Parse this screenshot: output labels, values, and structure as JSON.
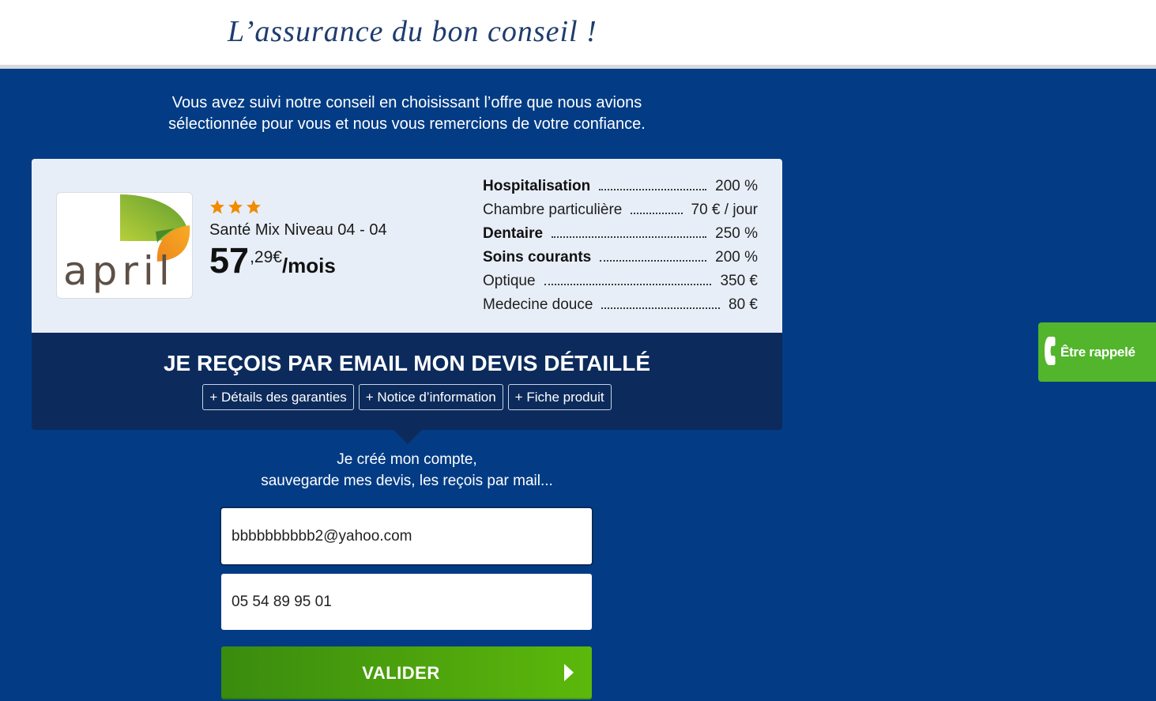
{
  "header": {
    "tagline": "L’assurance du bon conseil !"
  },
  "intro": {
    "line1": "Vous avez suivi notre conseil en choisissant l’offre que nous avions",
    "line2": "sélectionnée pour vous et nous vous remercions de votre confiance."
  },
  "offer": {
    "insurer_logo": {
      "text": "april",
      "icon": "april-logo"
    },
    "stars": 3,
    "rating_icon": "star-icon",
    "product_name": "Santé Mix Niveau 04 - 04",
    "price": {
      "integer": "57",
      "decimals": ",29€",
      "period": "/mois"
    },
    "guarantees": [
      {
        "label": "Hospitalisation",
        "value": "200 %",
        "emphasis": true
      },
      {
        "label": "Chambre particulière",
        "value": "70 € / jour",
        "emphasis": false
      },
      {
        "label": "Dentaire",
        "value": "250 %",
        "emphasis": true
      },
      {
        "label": "Soins courants",
        "value": "200 %",
        "emphasis": true
      },
      {
        "label": "Optique",
        "value": "350 €",
        "emphasis": false
      },
      {
        "label": "Medecine douce",
        "value": "80 €",
        "emphasis": false
      }
    ]
  },
  "cta": {
    "title": "JE REÇOIS PAR EMAIL MON DEVIS DÉTAILLÉ",
    "links": [
      "+ Détails des garanties",
      "+ Notice d’information",
      "+ Fiche produit"
    ]
  },
  "account": {
    "line1": "Je créé mon compte,",
    "line2": "sauvegarde mes devis, les reçois par mail..."
  },
  "form": {
    "email": {
      "value": "bbbbbbbbbb2@yahoo.com"
    },
    "phone": {
      "value": "05 54 89 95 01"
    },
    "submit": {
      "label": "VALIDER",
      "icon": "arrow-right-icon"
    }
  },
  "callback": {
    "label": "Être rappelé",
    "icon": "phone-icon"
  },
  "colors": {
    "page_background": "#033c85",
    "banner": "#0c2b5c",
    "card": "#e8eef8",
    "accent_green": "#52b52c",
    "accent_green_bright": "#5cb80b",
    "star": "#f08c00",
    "tagline": "#1e3c6e"
  }
}
